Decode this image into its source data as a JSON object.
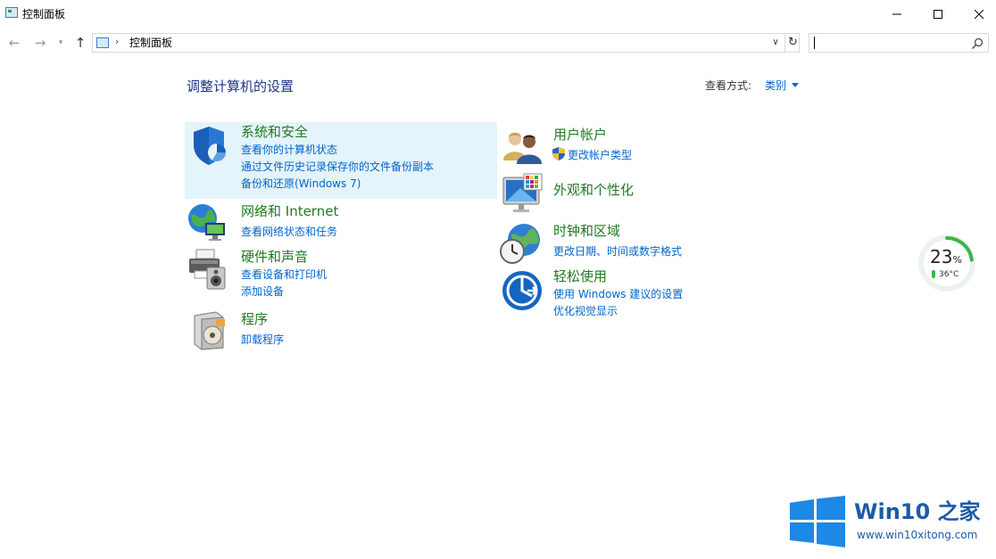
{
  "window": {
    "title": "控制面板",
    "controls": {
      "minimize": "minimize-icon",
      "maximize": "maximize-icon",
      "close": "close-icon"
    }
  },
  "navigation": {
    "back_icon": "arrow-left-icon",
    "forward_icon": "arrow-right-icon",
    "recent_icon": "chevron-down-icon",
    "up_icon": "arrow-up-icon",
    "breadcrumb_separator": "›",
    "address": "控制面板",
    "refresh_icon": "refresh-icon",
    "search": {
      "value": "",
      "icon": "search-icon"
    }
  },
  "main": {
    "heading": "调整计算机的设置",
    "view_by_label": "查看方式:",
    "view_by_value": "类别",
    "categories": [
      {
        "title": "系统和安全",
        "icon": "shield-icon",
        "links": [
          "查看你的计算机状态",
          "通过文件历史记录保存你的文件备份副本",
          "备份和还原(Windows 7)"
        ]
      },
      {
        "title": "网络和 Internet",
        "icon": "network-globe-icon",
        "links": [
          "查看网络状态和任务"
        ]
      },
      {
        "title": "硬件和声音",
        "icon": "printer-speaker-icon",
        "links": [
          "查看设备和打印机",
          "添加设备"
        ]
      },
      {
        "title": "程序",
        "icon": "programs-disc-icon",
        "links": [
          "卸载程序"
        ]
      },
      {
        "title": "用户帐户",
        "icon": "users-icon",
        "links": [
          "更改帐户类型"
        ],
        "link_icon": "uac-shield-icon"
      },
      {
        "title": "外观和个性化",
        "icon": "monitor-palette-icon",
        "links": []
      },
      {
        "title": "时钟和区域",
        "icon": "clock-globe-icon",
        "links": [
          "更改日期、时间或数字格式"
        ]
      },
      {
        "title": "轻松使用",
        "icon": "ease-of-access-icon",
        "links": [
          "使用 Windows 建议的设置",
          "优化视觉显示"
        ]
      }
    ]
  },
  "widget": {
    "cpu_percent": 23,
    "percent_sign": "%",
    "temperature": "36°C",
    "ring_color": "#3cb54a"
  },
  "watermark": {
    "title": "Win10 之家",
    "site": "www.win10xitong.com",
    "logo_icon": "windows-logo-icon"
  },
  "colors": {
    "heading": "#1e3287",
    "category_title": "#1f7a1f",
    "link": "#0066cc",
    "highlight": "#e5f3fb"
  }
}
